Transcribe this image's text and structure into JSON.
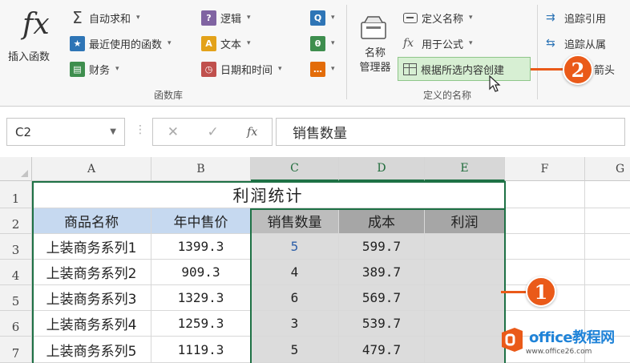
{
  "ribbon": {
    "insert_function": {
      "icon_text": "fx",
      "label": "插入函数"
    },
    "function_library": {
      "label": "函数库",
      "items": [
        {
          "label": "自动求和",
          "icon": "sigma-icon",
          "color": "#4a4a4a"
        },
        {
          "label": "最近使用的函数",
          "icon": "star-book-icon",
          "color": "#2e75b6"
        },
        {
          "label": "财务",
          "icon": "finance-icon",
          "color": "#3e8e4e"
        },
        {
          "label": "逻辑",
          "icon": "logic-icon",
          "color": "#8064a2"
        },
        {
          "label": "文本",
          "icon": "text-icon",
          "color": "#e3a21a"
        },
        {
          "label": "日期和时间",
          "icon": "clock-icon",
          "color": "#c0504d"
        }
      ],
      "more_icons": [
        {
          "icon": "lookup-icon",
          "color": "#2e75b6"
        },
        {
          "icon": "math-icon",
          "color": "#3e8e4e"
        },
        {
          "icon": "more-functions-icon",
          "color": "#e36c09"
        }
      ]
    },
    "defined_names": {
      "label": "定义的名称",
      "name_manager": "名称\n管理器",
      "define_name": "定义名称",
      "use_in_formula": "用于公式",
      "create_from_selection": "根据所选内容创建"
    },
    "formula_auditing": {
      "trace_precedents": "追踪引用",
      "trace_dependents": "追踪从属",
      "remove_arrows": "箭头"
    }
  },
  "formula_bar": {
    "name_box": "C2",
    "formula": "销售数量",
    "fx_label": "fx"
  },
  "sheet": {
    "columns": [
      "A",
      "B",
      "C",
      "D",
      "E",
      "F",
      "G"
    ],
    "rows": [
      "1",
      "2",
      "3",
      "4",
      "5",
      "6",
      "7"
    ],
    "title": "利润统计",
    "headers": [
      "商品名称",
      "年中售价",
      "销售数量",
      "成本",
      "利润"
    ],
    "data": [
      [
        "上装商务系列1",
        "1399.3",
        "5",
        "599.7",
        ""
      ],
      [
        "上装商务系列2",
        "909.3",
        "4",
        "389.7",
        ""
      ],
      [
        "上装商务系列3",
        "1329.3",
        "6",
        "569.7",
        ""
      ],
      [
        "上装商务系列4",
        "1259.3",
        "3",
        "539.7",
        ""
      ],
      [
        "上装商务系列5",
        "1119.3",
        "5",
        "479.7",
        ""
      ]
    ]
  },
  "callouts": {
    "one": "1",
    "two": "2"
  },
  "watermark": {
    "brand": "office教程网",
    "url": "www.office26.com"
  }
}
